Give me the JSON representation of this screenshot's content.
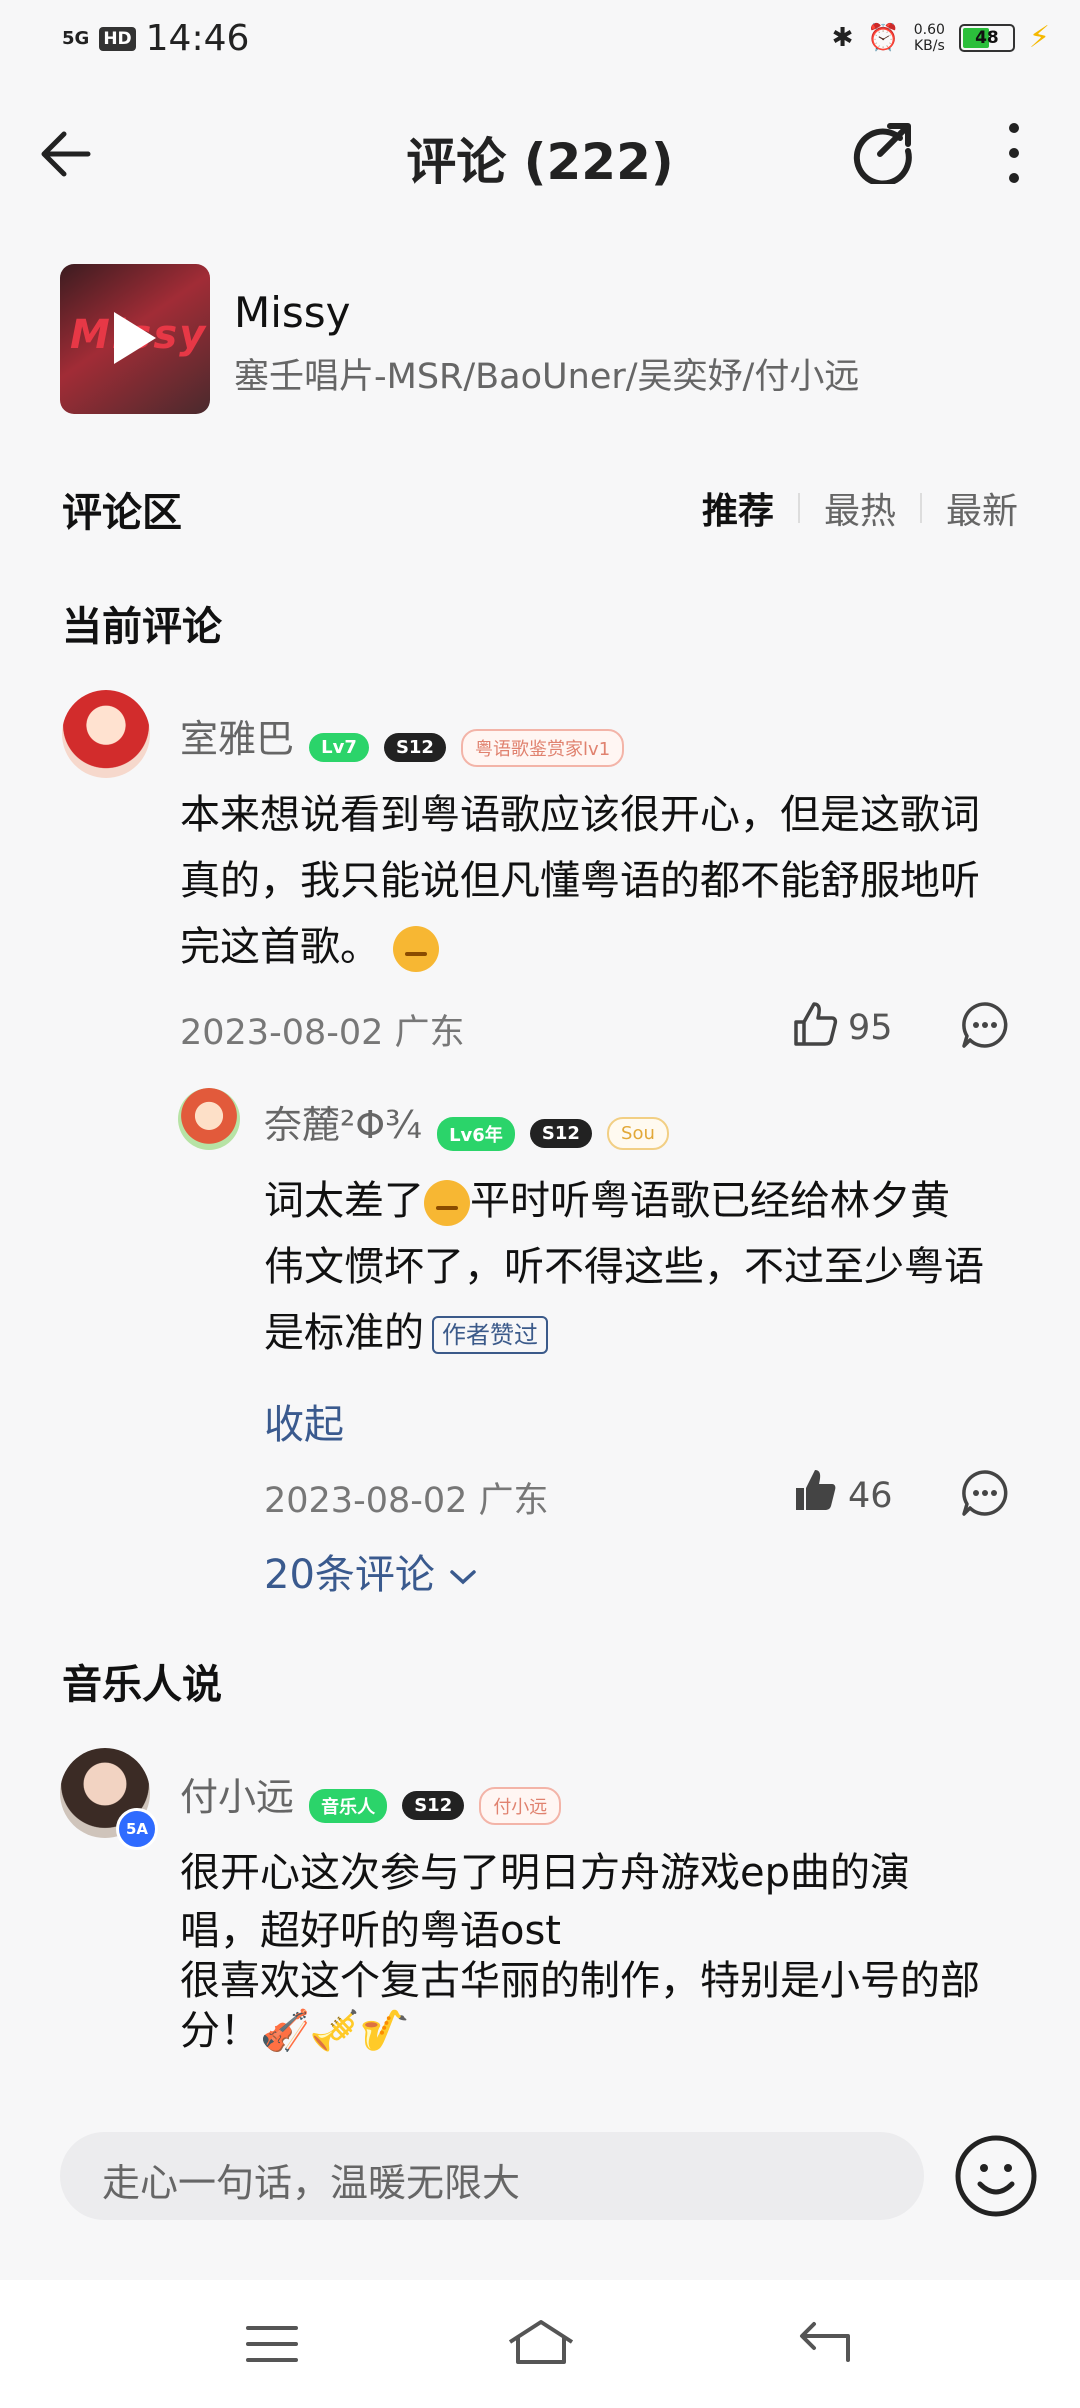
{
  "status_bar": {
    "network": "5G",
    "hd": "HD",
    "time": "14:46",
    "netspeed_value": "0.60",
    "netspeed_unit": "KB/s",
    "battery": "48"
  },
  "header": {
    "title": "评论 (222)"
  },
  "song": {
    "title": "Missy",
    "artists": "塞壬唱片-MSR/BaoUner/吴奕妤/付小远",
    "cover_text": "Missy"
  },
  "comment_area": {
    "title": "评论区",
    "sorts": [
      "推荐",
      "最热",
      "最新"
    ]
  },
  "current_section": "当前评论",
  "main_comment": {
    "user": "室雅巴",
    "badges": [
      "Lv7",
      "S12",
      "粤语歌鉴赏家lv1"
    ],
    "lines": [
      "本来想说看到粤语歌应该很开心，但是这歌词",
      "真的，我只能说但凡懂粤语的都不能舒服地听",
      "完这首歌。"
    ],
    "date_loc": "2023-08-02 广东",
    "likes": "95"
  },
  "reply": {
    "user": "奈麓²Φ¾",
    "badges": [
      "Lv6年",
      "S12",
      "Sou"
    ],
    "line1_a": "词太差了",
    "line1_b": "平时听粤语歌已经给林夕黄",
    "line2": "伟文惯坏了，听不得这些，不过至少粤语",
    "line3": "是标准的",
    "author_liked": "作者赞过",
    "collapse": "收起",
    "date_loc": "2023-08-02 广东",
    "likes": "46"
  },
  "more_replies": "20条评论",
  "music_section": "音乐人说",
  "musician_comment": {
    "user": "付小远",
    "avatar_badge": "5A",
    "badges": [
      "音乐人",
      "S12",
      "付小远"
    ],
    "lines": [
      "很开心这次参与了明日方舟游戏ep曲的演",
      "唱，超好听的粤语ost",
      "很喜欢这个复古华丽的制作，特别是小号的部",
      "分！"
    ],
    "emojis": "🎻🎺🎷"
  },
  "input": {
    "placeholder": "走心一句话，温暖无限大"
  }
}
